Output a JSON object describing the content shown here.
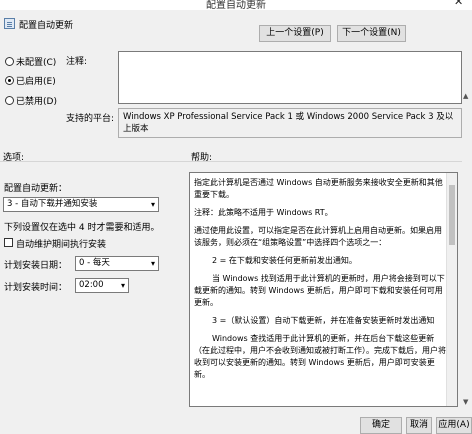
{
  "window": {
    "title": "配置自动更新",
    "close_glyph": "✕"
  },
  "header": {
    "policy_name": "配置自动更新",
    "icon": "policy-settings-icon",
    "prev_button": "上一个设置(P)",
    "next_button": "下一个设置(N)"
  },
  "state_options": [
    {
      "label": "未配置(C)",
      "selected": false
    },
    {
      "label": "已启用(E)",
      "selected": true
    },
    {
      "label": "已禁用(D)",
      "selected": false
    }
  ],
  "comment": {
    "label": "注释:",
    "value": ""
  },
  "platform": {
    "label": "支持的平台:",
    "value": "Windows XP Professional Service Pack 1 或 Windows 2000 Service Pack 3 及以上版本"
  },
  "options": {
    "section_label": "选项:",
    "configure_label": "配置自动更新：",
    "configure_value": "3 - 自动下载并通知安装",
    "note": "下列设置仅在选中 4 时才需要和适用。",
    "maintenance_checkbox": {
      "label": "自动维护期间执行安装",
      "checked": false
    },
    "schedule_day": {
      "label": "计划安装日期：",
      "value": "0 - 每天"
    },
    "schedule_time": {
      "label": "计划安装时间：",
      "value": "02:00"
    }
  },
  "help": {
    "section_label": "帮助:",
    "paragraphs": [
      "指定此计算机是否通过 Windows 自动更新服务来接收安全更新和其他重要下载。",
      "注释：此策略不适用于 Windows RT。",
      "通过使用此设置，可以指定是否在此计算机上启用自动更新。如果启用该服务，则必须在“组策略设置”中选择四个选项之一：",
      "2 = 在下载和安装任何更新前发出通知。",
      "当 Windows 找到适用于此计算机的更新时，用户将会接到可以下载更新的通知。转到 Windows 更新后，用户即可下载和安装任何可用更新。",
      "3 =（默认设置）自动下载更新，并在准备安装更新时发出通知",
      "Windows 查找适用于此计算机的更新，并在后台下载这些更新（在此过程中，用户不会收到通知或被打断工作）。完成下载后，用户将收到可以安装更新的通知。转到 Windows 更新后，用户即可安装更新。"
    ]
  },
  "footer": {
    "ok": "确定",
    "cancel": "取消",
    "apply": "应用(A)"
  }
}
